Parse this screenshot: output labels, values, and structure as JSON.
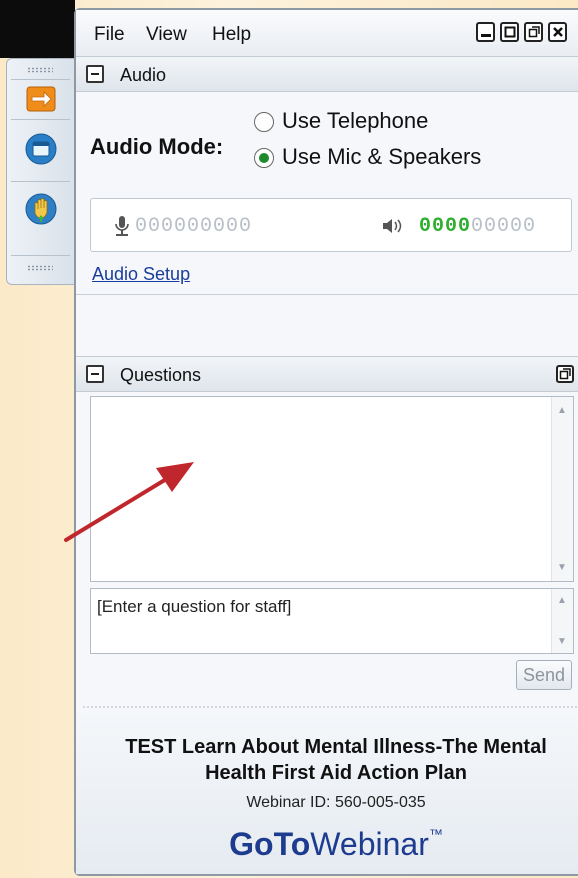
{
  "menu": {
    "file": "File",
    "view": "View",
    "help": "Help"
  },
  "audio": {
    "section_title": "Audio",
    "mode_label": "Audio Mode:",
    "options": [
      "Use Telephone",
      "Use Mic & Speakers"
    ],
    "selected": "Use Mic & Speakers",
    "mic_digits": "000000000",
    "speaker_level_active": "0000",
    "speaker_level_rest": "00000",
    "setup_link": "Audio Setup"
  },
  "questions": {
    "section_title": "Questions",
    "input_placeholder": "[Enter a question for staff]",
    "send_label": "Send"
  },
  "webinar": {
    "title": "TEST Learn About Mental Illness-The Mental Health First Aid Action Plan",
    "id_text": "Webinar ID: 560-005-035",
    "brand_goto": "GoTo",
    "brand_webinar": "Webinar",
    "brand_tm": "™"
  },
  "colors": {
    "accent_green": "#2fae2f",
    "brand_blue": "#1d3c8f",
    "arrow_red": "#c0272d"
  }
}
